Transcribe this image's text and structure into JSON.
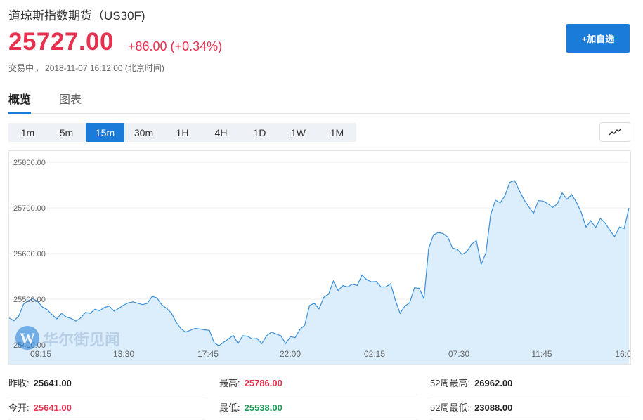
{
  "header": {
    "title": "道琼斯指数期货（US30F)",
    "price": "25727.00",
    "change": "+86.00 (+0.34%)",
    "status_label": "交易中",
    "timestamp": "2018-11-07 16:12:00",
    "timezone": "(北京时间)",
    "add_watch_label": "+加自选"
  },
  "tabs": [
    {
      "label": "概览",
      "active": true
    },
    {
      "label": "图表",
      "active": false
    }
  ],
  "intervals": [
    "1m",
    "5m",
    "15m",
    "30m",
    "1H",
    "4H",
    "1D",
    "1W",
    "1M"
  ],
  "active_interval": "15m",
  "chart_type_icon": "line-chart-icon",
  "watermark": "华尔街见闻",
  "chart_data": {
    "type": "area",
    "y_ticks": [
      "25800.00",
      "25700.00",
      "25600.00",
      "25500.00",
      "25400.00"
    ],
    "x_ticks": [
      "09:15",
      "13:30",
      "17:45",
      "22:00",
      "02:15",
      "07:30",
      "11:45",
      "16:0"
    ],
    "ylim": [
      25380,
      25815
    ],
    "grid": true,
    "series": [
      {
        "values": [
          25459,
          25453,
          25463,
          25489,
          25497,
          25501,
          25495,
          25483,
          25477,
          25466,
          25457,
          25469,
          25461,
          25458,
          25452,
          25459,
          25471,
          25469,
          25478,
          25475,
          25482,
          25485,
          25474,
          25480,
          25487,
          25492,
          25494,
          25491,
          25488,
          25491,
          25506,
          25503,
          25488,
          25480,
          25470,
          25450,
          25436,
          25428,
          25432,
          25436,
          25435,
          25433,
          25432,
          25405,
          25398,
          25406,
          25413,
          25421,
          25403,
          25420,
          25419,
          25413,
          25414,
          25403,
          25420,
          25428,
          25424,
          25420,
          25403,
          25418,
          25416,
          25434,
          25443,
          25486,
          25491,
          25479,
          25504,
          25511,
          25540,
          25519,
          25530,
          25527,
          25533,
          25530,
          25553,
          25543,
          25538,
          25539,
          25527,
          25527,
          25534,
          25498,
          25469,
          25485,
          25492,
          25525,
          25524,
          25501,
          25611,
          25641,
          25646,
          25644,
          25636,
          25612,
          25609,
          25598,
          25604,
          25621,
          25628,
          25576,
          25602,
          25685,
          25717,
          25711,
          25727,
          25756,
          25760,
          25738,
          25718,
          25702,
          25688,
          25716,
          25715,
          25709,
          25701,
          25709,
          25733,
          25719,
          25729,
          25712,
          25690,
          25658,
          25672,
          25657,
          25677,
          25667,
          25651,
          25637,
          25658,
          25655,
          25700
        ],
        "color": "#3a8fd8"
      }
    ]
  },
  "stats": {
    "prev_close": {
      "label": "昨收:",
      "value": "25641.00"
    },
    "open": {
      "label": "今开:",
      "value": "25641.00"
    },
    "high": {
      "label": "最高:",
      "value": "25786.00"
    },
    "low": {
      "label": "最低:",
      "value": "25538.00"
    },
    "high_52w": {
      "label": "52周最高:",
      "value": "26962.00"
    },
    "low_52w": {
      "label": "52周最低:",
      "value": "23088.00"
    }
  },
  "colors": {
    "accent": "#1a7bd8",
    "up": "#e8304f",
    "down": "#1a9e56",
    "area_fill": "#dcedfb",
    "line": "#3a8fd8"
  }
}
